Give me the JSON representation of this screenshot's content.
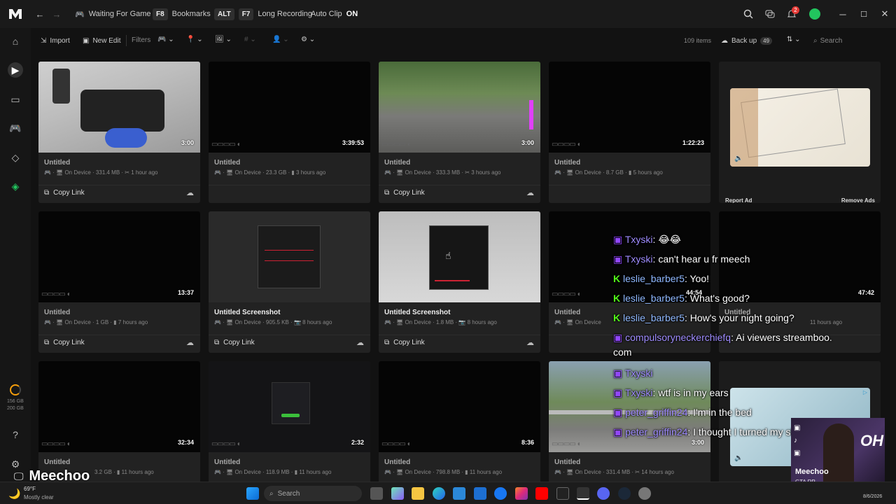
{
  "topbar": {
    "status": "Waiting For Game",
    "bookmarks_key": "F8",
    "bookmarks_label": "Bookmarks",
    "alt_key": "ALT",
    "record_key": "F7",
    "record_label": "Long Recording",
    "autoclip_label": "Auto Clip",
    "autoclip_state": "ON",
    "notification_count": "2"
  },
  "sidebar": {
    "storage_used": "156 GB",
    "storage_total": "200 GB",
    "streamer_name": "Meechoo"
  },
  "toolbar": {
    "import_label": "Import",
    "new_edit_label": "New Edit",
    "filters_label": "Filters",
    "items_count": "109 items",
    "backup_label": "Back up",
    "backup_count": "49",
    "search_placeholder": "Search"
  },
  "cards": [
    {
      "duration": "3:00",
      "title": "Untitled",
      "location": "On Device",
      "size": "331.4 MB",
      "time": "1 hour ago",
      "copy": "Copy Link"
    },
    {
      "duration": "3:39:53",
      "title": "Untitled",
      "location": "On Device",
      "size": "23.3 GB",
      "time": "3 hours ago",
      "copy": ""
    },
    {
      "duration": "3:00",
      "title": "Untitled",
      "location": "On Device",
      "size": "333.3 MB",
      "time": "3 hours ago",
      "copy": "Copy Link"
    },
    {
      "duration": "1:22:23",
      "title": "Untitled",
      "location": "On Device",
      "size": "8.7 GB",
      "time": "5 hours ago",
      "copy": ""
    },
    {
      "duration": "13:37",
      "title": "Untitled",
      "location": "On Device",
      "size": "1 GB",
      "time": "7 hours ago",
      "copy": "Copy Link"
    },
    {
      "duration": "",
      "title": "Untitled Screenshot",
      "location": "On Device",
      "size": "905.5 KB",
      "time": "8 hours ago",
      "copy": "Copy Link"
    },
    {
      "duration": "",
      "title": "Untitled Screenshot",
      "location": "On Device",
      "size": "1.8 MB",
      "time": "8 hours ago",
      "copy": "Copy Link"
    },
    {
      "duration": "44:54",
      "title": "Untitled",
      "location": "On Device",
      "size": "",
      "time": "",
      "copy": ""
    },
    {
      "duration": "47:42",
      "title": "Untitled",
      "location": "",
      "size": "",
      "time": "11 hours ago",
      "copy": ""
    },
    {
      "duration": "32:34",
      "title": "Untitled",
      "location": "",
      "size": "3.2 GB",
      "time": "11 hours ago",
      "copy": ""
    },
    {
      "duration": "2:32",
      "title": "Untitled",
      "location": "On Device",
      "size": "118.9 MB",
      "time": "11 hours ago",
      "copy": ""
    },
    {
      "duration": "8:36",
      "title": "Untitled",
      "location": "On Device",
      "size": "798.8 MB",
      "time": "11 hours ago",
      "copy": ""
    },
    {
      "duration": "3:00",
      "title": "Untitled",
      "location": "On Device",
      "size": "331.4 MB",
      "time": "14 hours ago",
      "copy": ""
    }
  ],
  "ad": {
    "report_label": "Report Ad",
    "remove_label": "Remove Ads"
  },
  "chat": [
    {
      "user": "Txyski",
      "message": "😂😂",
      "platform": "twitch"
    },
    {
      "user": "Txyski",
      "message": "can't hear u fr meech",
      "platform": "twitch"
    },
    {
      "user": "leslie_barber5",
      "message": "Yoo!",
      "platform": "kick"
    },
    {
      "user": "leslie_barber5",
      "message": "What's good?",
      "platform": "kick"
    },
    {
      "user": "leslie_barber5",
      "message": "How's your night going?",
      "platform": "kick"
    },
    {
      "user": "compulsoryneckerchiefq",
      "message": "Ai viewers streamboo.",
      "platform": "twitch"
    },
    {
      "user": "",
      "message": "com",
      "platform": ""
    },
    {
      "user": "Txyski",
      "message": "",
      "platform": "twitch"
    },
    {
      "user": "Txyski",
      "message": "wtf is in my ears",
      "platform": "twitch"
    },
    {
      "user": "peter_griffin24",
      "message": "I'm in the bed",
      "platform": "twitch"
    },
    {
      "user": "peter_griffin24",
      "message": "I thought I turned my shut off",
      "platform": "twitch"
    }
  ],
  "webcam": {
    "name": "Meechoo",
    "subtitle": "GTA RP"
  },
  "taskbar": {
    "temperature": "69°F",
    "weather": "Mostly clear",
    "search_placeholder": "Search",
    "date": "8/6/2026"
  },
  "colors": {
    "accent_green": "#22c55e",
    "twitch_purple": "#9146ff",
    "kick_green": "#53fc18",
    "notification_red": "#e53935"
  }
}
